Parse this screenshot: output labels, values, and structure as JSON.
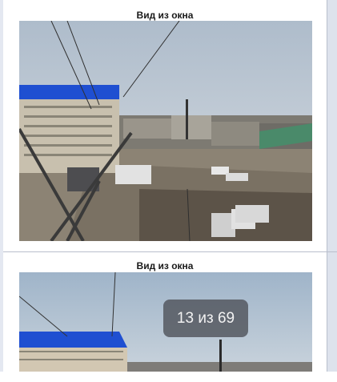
{
  "gallery": {
    "items": [
      {
        "caption": "Вид из окна"
      },
      {
        "caption": "Вид из окна"
      }
    ]
  },
  "viewer": {
    "current": "13",
    "separator": "из",
    "total": "69"
  },
  "colors": {
    "page_background": "#e4e8f1",
    "card_background": "#ffffff",
    "counter_background": "#50545c",
    "roof_blue": "#1f4fd1"
  }
}
